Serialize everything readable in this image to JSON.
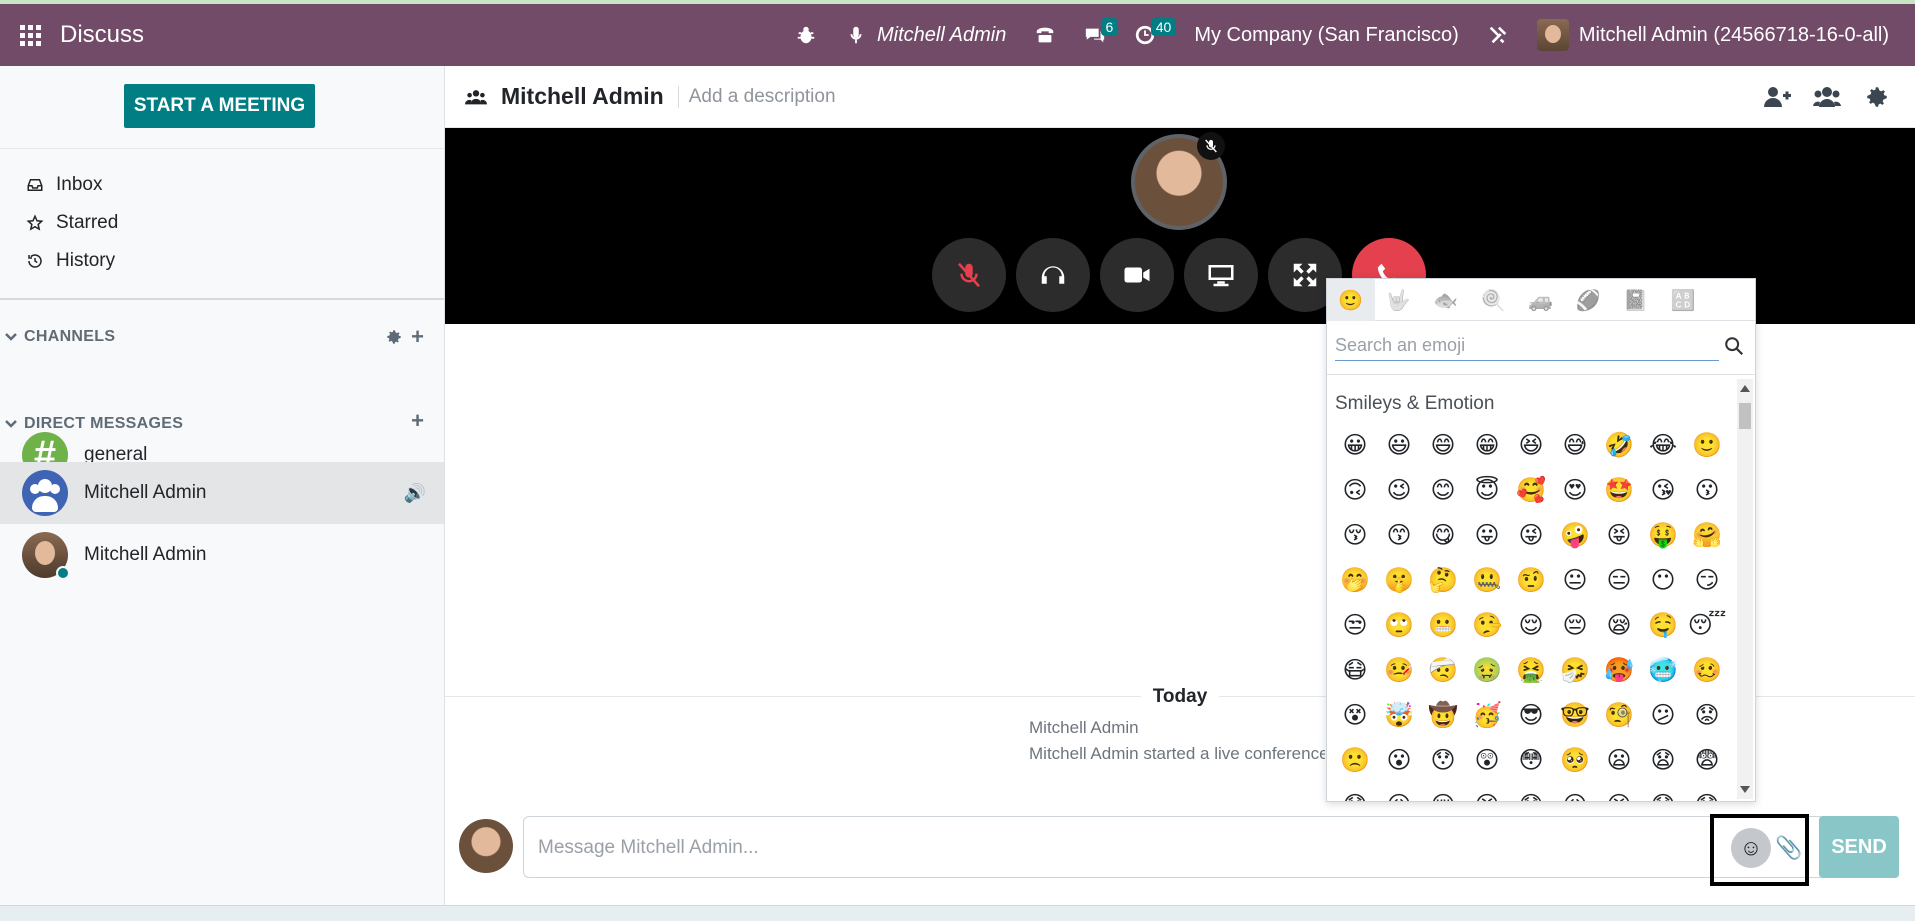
{
  "navbar": {
    "app_title": "Discuss",
    "voice_user": "Mitchell Admin",
    "messages_badge": "6",
    "activities_badge": "40",
    "company": "My Company (San Francisco)",
    "user": "Mitchell Admin (24566718-16-0-all)",
    "icons": [
      "apps-grid-icon",
      "bug-icon",
      "microphone-icon",
      "phone-icon",
      "comments-icon",
      "clock-icon",
      "tools-icon"
    ],
    "color": "#714B67"
  },
  "sidebar": {
    "start_meeting": "START A MEETING",
    "mailboxes": [
      {
        "label": "Inbox",
        "icon": "inbox-icon"
      },
      {
        "label": "Starred",
        "icon": "star-icon"
      },
      {
        "label": "History",
        "icon": "history-icon"
      }
    ],
    "channels_title": "CHANNELS",
    "channels": [
      {
        "label": "general"
      }
    ],
    "dm_title": "DIRECT MESSAGES",
    "direct_messages": [
      {
        "label": "Mitchell Admin",
        "active": true
      },
      {
        "label": "Mitchell Admin",
        "active": false
      }
    ]
  },
  "thread": {
    "name": "Mitchell Admin",
    "description_placeholder": "Add a description",
    "header_icons": [
      "add-user-icon",
      "members-icon",
      "settings-icon"
    ]
  },
  "call": {
    "buttons": [
      "mute-icon",
      "headphones-icon",
      "camera-icon",
      "screen-share-icon",
      "fullscreen-icon",
      "hangup-icon"
    ],
    "hangup_color": "#e4404e"
  },
  "messages": {
    "date_separator": "Today",
    "author": "Mitchell Admin",
    "text": "Mitchell Admin started a live conference"
  },
  "composer": {
    "placeholder": "Message Mitchell Admin...",
    "send_label": "SEND"
  },
  "emoji_picker": {
    "search_placeholder": "Search an emoji",
    "category_tabs": [
      "🙂",
      "🤟",
      "🐟",
      "🍭",
      "🚙",
      "🏈",
      "📓",
      "🔠"
    ],
    "category_title": "Smileys & Emotion",
    "emojis": [
      "😀",
      "😃",
      "😄",
      "😁",
      "😆",
      "😅",
      "🤣",
      "😂",
      "🙂",
      "🙃",
      "😉",
      "😊",
      "😇",
      "🥰",
      "😍",
      "🤩",
      "😘",
      "😗",
      "😚",
      "😙",
      "😋",
      "😛",
      "😜",
      "🤪",
      "😝",
      "🤑",
      "🤗",
      "🤭",
      "🤫",
      "🤔",
      "🤐",
      "🤨",
      "😐",
      "😑",
      "😶",
      "😏",
      "😒",
      "🙄",
      "😬",
      "🤥",
      "😌",
      "😔",
      "😪",
      "🤤",
      "😴",
      "😷",
      "🤒",
      "🤕",
      "🤢",
      "🤮",
      "🤧",
      "🥵",
      "🥶",
      "🥴",
      "😵",
      "🤯",
      "🤠",
      "🥳",
      "😎",
      "🤓",
      "🧐",
      "😕",
      "😟",
      "🙁",
      "😮",
      "😯",
      "😲",
      "😳",
      "🥺",
      "😦",
      "😧",
      "😨",
      "😰",
      "😥",
      "😢",
      "😭",
      "😱",
      "😖",
      "😣",
      "😞",
      "😓"
    ]
  }
}
